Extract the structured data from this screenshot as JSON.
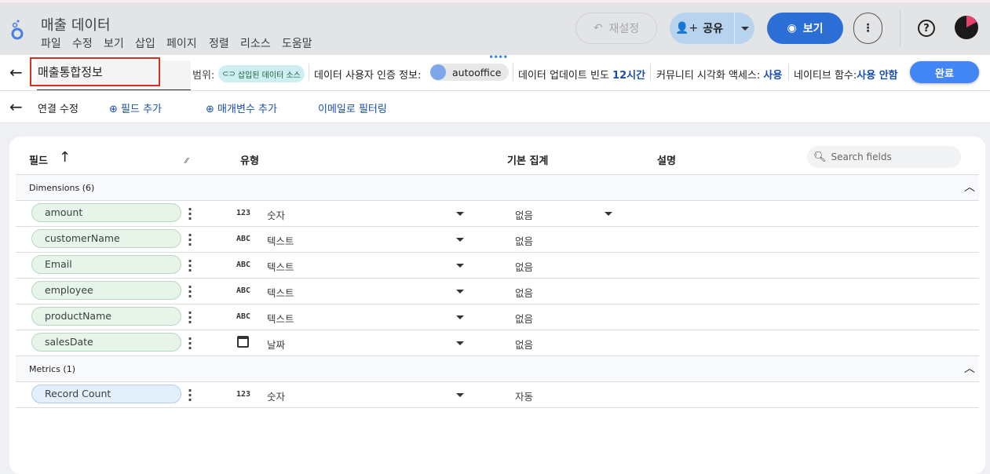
{
  "app": {
    "title": "매출 데이터",
    "menu": [
      "파일",
      "수정",
      "보기",
      "삽입",
      "페이지",
      "정렬",
      "리소스",
      "도움말"
    ],
    "reset": "재설정",
    "share": "공유",
    "view": "보기"
  },
  "datasource": {
    "name": "매출통합정보",
    "scope_label": "범위:",
    "scope_value": "삽입된 데이터 소스",
    "credentials_label": "데이터 사용자 인증 정보:",
    "credentials_value": "autooffice",
    "freshness_label": "데이터 업데이트 빈도",
    "freshness_value": "12시간",
    "community_label": "커뮤니티 시각화 액세스:",
    "community_value": "사용",
    "native_label": "네이티브 함수:",
    "native_value": "사용 안함",
    "done": "완료"
  },
  "toolbar": {
    "edit_connection": "연결 수정",
    "add_field": "필드 추가",
    "add_param": "매개변수 추가",
    "filter_email": "이메일로 필터링"
  },
  "table": {
    "headers": {
      "field": "필드",
      "type": "유형",
      "aggregation": "기본 집계",
      "description": "설명"
    },
    "search_placeholder": "Search fields",
    "dimensions_label": "Dimensions (6)",
    "metrics_label": "Metrics (1)",
    "dimensions": [
      {
        "name": "amount",
        "type_icon": "123",
        "type": "숫자",
        "aggregation": "없음"
      },
      {
        "name": "customerName",
        "type_icon": "ABC",
        "type": "텍스트",
        "aggregation": "없음"
      },
      {
        "name": "Email",
        "type_icon": "ABC",
        "type": "텍스트",
        "aggregation": "없음"
      },
      {
        "name": "employee",
        "type_icon": "ABC",
        "type": "텍스트",
        "aggregation": "없음"
      },
      {
        "name": "productName",
        "type_icon": "ABC",
        "type": "텍스트",
        "aggregation": "없음"
      },
      {
        "name": "salesDate",
        "type_icon": "calendar-icon",
        "type": "날짜",
        "aggregation": "없음"
      }
    ],
    "metrics": [
      {
        "name": "Record Count",
        "type_icon": "123",
        "type": "숫자",
        "aggregation": "자동"
      }
    ]
  },
  "colors": {
    "accent": "#4285f4",
    "view_button": "#2b6fd6",
    "share_button": "#b7d3ee",
    "dimension_chip": "#e6f4ea",
    "metric_chip": "#e3effb",
    "highlight_box": "#d93025"
  }
}
